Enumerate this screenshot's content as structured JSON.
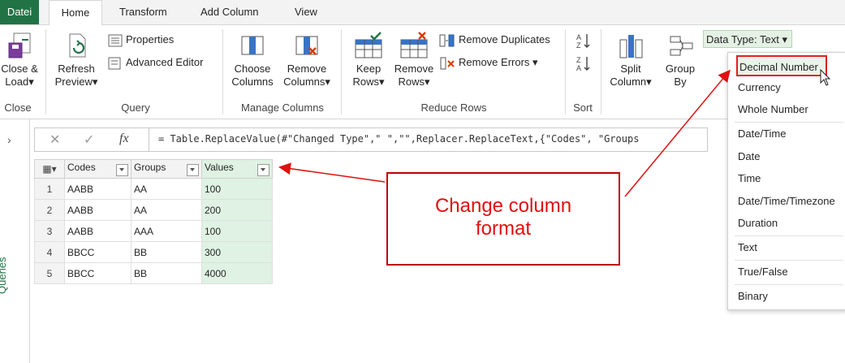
{
  "tabs": {
    "file": "Datei",
    "home": "Home",
    "transform": "Transform",
    "add_column": "Add Column",
    "view": "View"
  },
  "ribbon": {
    "close_group": {
      "btn_line1": "Close &",
      "btn_line2": "Load",
      "label": "Close"
    },
    "query_group": {
      "refresh_line1": "Refresh",
      "refresh_line2": "Preview",
      "properties": "Properties",
      "advanced_editor": "Advanced Editor",
      "label": "Query"
    },
    "manage_group": {
      "choose_line1": "Choose",
      "choose_line2": "Columns",
      "remove_line1": "Remove",
      "remove_line2": "Columns",
      "label": "Manage Columns"
    },
    "reduce_group": {
      "keep_line1": "Keep",
      "keep_line2": "Rows",
      "remove_line1": "Remove",
      "remove_line2": "Rows",
      "remove_duplicates": "Remove Duplicates",
      "remove_errors": "Remove Errors",
      "label": "Reduce Rows"
    },
    "sort_group": {
      "label": "Sort"
    },
    "split_group": {
      "line1": "Split",
      "line2": "Column"
    },
    "groupby_group": {
      "line1": "Group",
      "line2": "By"
    },
    "data_type": "Data Type: Text"
  },
  "queries_pane": {
    "label": "Queries"
  },
  "formula": {
    "fx": "fx",
    "text": "= Table.ReplaceValue(#\"Changed Type\",\" \",\"\",Replacer.ReplaceText,{\"Codes\", \"Groups"
  },
  "table": {
    "headers": [
      "Codes",
      "Groups",
      "Values"
    ],
    "rows": [
      {
        "n": "1",
        "codes": "AABB",
        "groups": "AA",
        "values": "100"
      },
      {
        "n": "2",
        "codes": "AABB",
        "groups": "AA",
        "values": "200"
      },
      {
        "n": "3",
        "codes": "AABB",
        "groups": "AAA",
        "values": "100"
      },
      {
        "n": "4",
        "codes": "BBCC",
        "groups": "BB",
        "values": "300"
      },
      {
        "n": "5",
        "codes": "BBCC",
        "groups": "BB",
        "values": "4000"
      }
    ]
  },
  "dtype_menu": {
    "items": [
      "Decimal Number",
      "Currency",
      "Whole Number",
      "Date/Time",
      "Date",
      "Time",
      "Date/Time/Timezone",
      "Duration",
      "Text",
      "True/False",
      "Binary"
    ]
  },
  "callout": {
    "line1": "Change column",
    "line2": "format"
  },
  "colors": {
    "accent": "#217346",
    "annotation": "#e01010",
    "value_column": "#dff2e3"
  }
}
